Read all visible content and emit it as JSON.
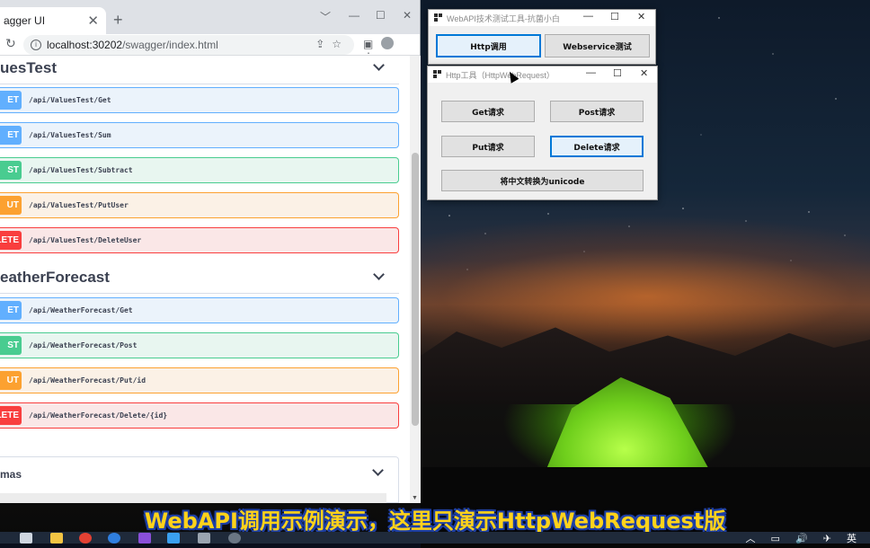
{
  "browser": {
    "tab_title": "agger UI",
    "tab_close": "✕",
    "new_tab": "+",
    "url_host": "localhost:30202",
    "url_path": "/swagger/index.html",
    "min_label": "﹀",
    "restore_label": "☐",
    "close_label": "✕"
  },
  "swagger": {
    "sections": [
      {
        "title": "uesTest",
        "operations": [
          {
            "method": "ET",
            "kind": "get",
            "path": "/api/ValuesTest/Get"
          },
          {
            "method": "ET",
            "kind": "get",
            "path": "/api/ValuesTest/Sum"
          },
          {
            "method": "ST",
            "kind": "post",
            "path": "/api/ValuesTest/Subtract"
          },
          {
            "method": "UT",
            "kind": "put",
            "path": "/api/ValuesTest/PutUser"
          },
          {
            "method": "LETE",
            "kind": "delete",
            "path": "/api/ValuesTest/DeleteUser"
          }
        ]
      },
      {
        "title": "eatherForecast",
        "operations": [
          {
            "method": "ET",
            "kind": "get",
            "path": "/api/WeatherForecast/Get"
          },
          {
            "method": "ST",
            "kind": "post",
            "path": "/api/WeatherForecast/Post"
          },
          {
            "method": "UT",
            "kind": "put",
            "path": "/api/WeatherForecast/Put/id"
          },
          {
            "method": "LETE",
            "kind": "delete",
            "path": "/api/WeatherForecast/Delete/{id}"
          }
        ]
      }
    ],
    "schemas_title": "mas"
  },
  "main_window": {
    "title": "WebAPI技术测试工具-抗菌小白",
    "http_button": "Http调用",
    "webservice_button": "Webservice测试",
    "min": "—",
    "max": "☐",
    "close": "✕"
  },
  "http_window": {
    "title": "Http工具（HttpWebRequest）",
    "get_button": "Get请求",
    "post_button": "Post请求",
    "put_button": "Put请求",
    "delete_button": "Delete请求",
    "unicode_button": "将中文转换为unicode",
    "min": "—",
    "max": "☐",
    "close": "✕"
  },
  "subtitle": "WebAPI调用示例演示，这里只演示HttpWebRequest版",
  "taskbar": {
    "tray_text": "英"
  },
  "colors": {
    "get": "#61affe",
    "post": "#49cc90",
    "put": "#fca130",
    "delete": "#f93e3e",
    "focus": "#0078d7",
    "subtitle": "#ffd21a"
  }
}
